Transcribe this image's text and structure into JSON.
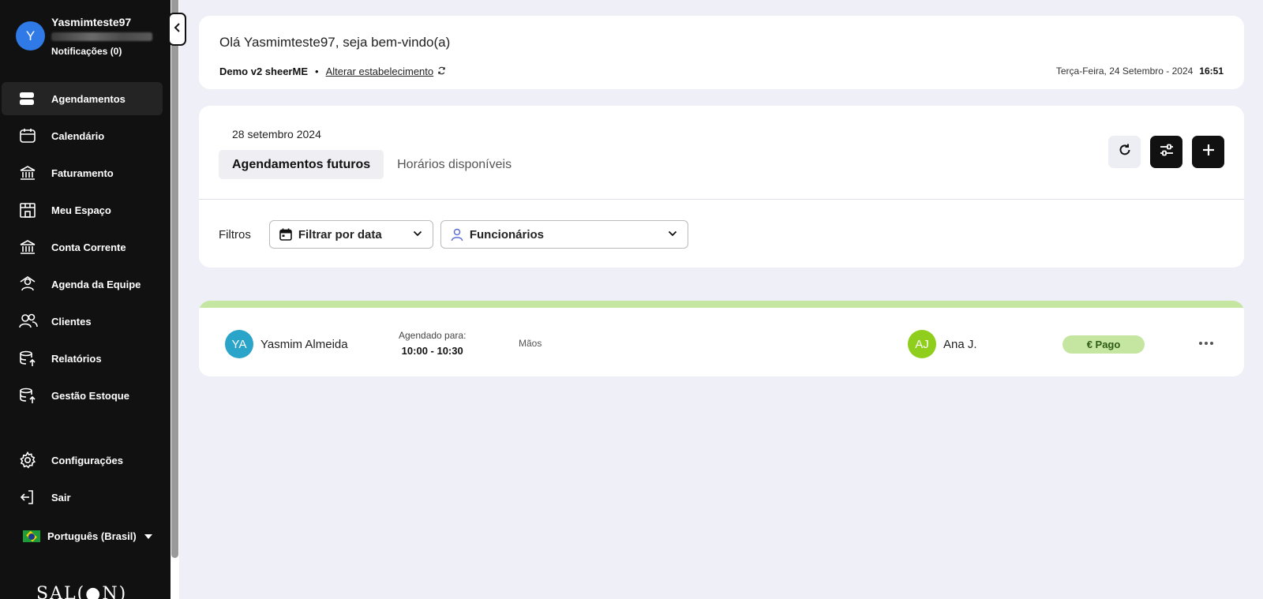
{
  "sidebar": {
    "user": {
      "initial": "Y",
      "name": "Yasmimteste97",
      "notifications": "Notificações (0)"
    },
    "items": [
      {
        "label": "Agendamentos",
        "icon": "list-icon",
        "active": true
      },
      {
        "label": "Calendário",
        "icon": "calendar-icon"
      },
      {
        "label": "Faturamento",
        "icon": "bank-icon"
      },
      {
        "label": "Meu Espaço",
        "icon": "store-icon"
      },
      {
        "label": "Conta Corrente",
        "icon": "bank-icon"
      },
      {
        "label": "Agenda da Equipe",
        "icon": "team-agenda-icon"
      },
      {
        "label": "Clientes",
        "icon": "users-icon"
      },
      {
        "label": "Relatórios",
        "icon": "reports-icon"
      },
      {
        "label": "Gestão Estoque",
        "icon": "stock-icon"
      }
    ],
    "bottom_items": [
      {
        "label": "Configurações",
        "icon": "gear-icon"
      },
      {
        "label": "Sair",
        "icon": "logout-icon"
      }
    ],
    "language": "Português (Brasil)",
    "logo_text": "SAL(●N)"
  },
  "header": {
    "greeting": "Olá Yasmimteste97, seja bem-vindo(a)",
    "establishment": "Demo v2 sheerME",
    "separator": "•",
    "change_link": "Alterar estabelecimento",
    "date": "Terça-Feira, 24 Setembro - 2024",
    "time": "16:51"
  },
  "appointments": {
    "selected_date": "28 setembro 2024",
    "tabs": [
      {
        "label": "Agendamentos futuros",
        "active": true
      },
      {
        "label": "Horários disponíveis",
        "active": false
      }
    ],
    "filters_label": "Filtros",
    "date_filter": "Filtrar por data",
    "staff_filter": "Funcionários"
  },
  "booking": {
    "client_initials": "YA",
    "client_name": "Yasmim Almeida",
    "scheduled_label": "Agendado para:",
    "scheduled_time": "10:00 - 10:30",
    "service": "Mãos",
    "staff_initials": "AJ",
    "staff_name": "Ana J.",
    "status": "€ Pago"
  },
  "colors": {
    "sidebar_bg": "#111111",
    "page_bg": "#efeff7",
    "user_avatar": "#2f7ae6",
    "client_avatar": "#2aa4c8",
    "staff_avatar": "#8fce1c",
    "paid_badge": "#c4e6a0"
  }
}
